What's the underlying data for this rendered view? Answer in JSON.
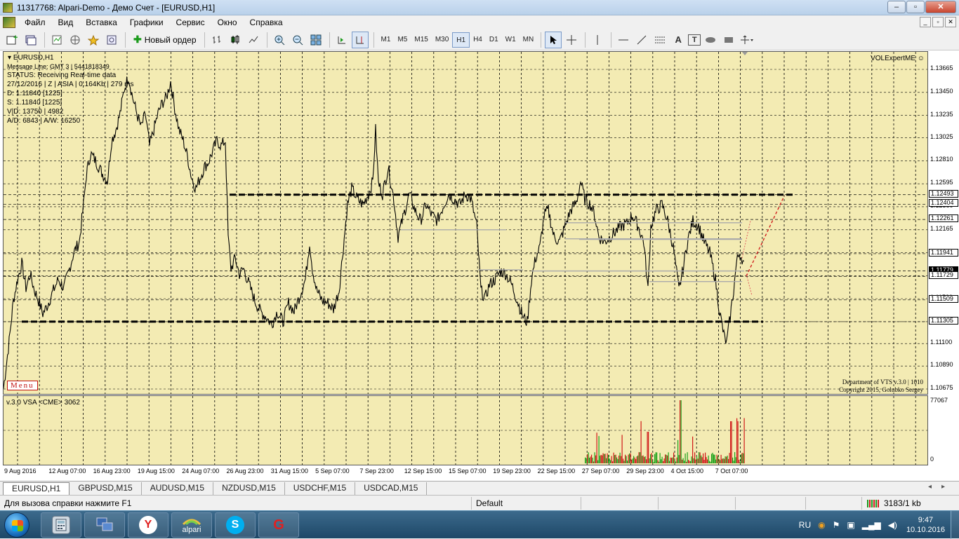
{
  "window": {
    "title": "11317768: Alpari-Demo - Демо Счет - [EURUSD,H1]",
    "buttons": {
      "minimize": "–",
      "maximize": "▫",
      "close": "✕"
    }
  },
  "menu": {
    "items": [
      "Файл",
      "Вид",
      "Вставка",
      "Графики",
      "Сервис",
      "Окно",
      "Справка"
    ],
    "mdi": {
      "minimize": "_",
      "restore": "▫",
      "close": "✕"
    }
  },
  "toolbar": {
    "new_order": "Новый ордер",
    "timeframes": [
      "M1",
      "M5",
      "M15",
      "M30",
      "H1",
      "H4",
      "D1",
      "W1",
      "MN"
    ],
    "active_timeframe": "H1",
    "text_tool": "A",
    "text_label_tool": "T"
  },
  "chart": {
    "symbol_label": "EURUSD,H1",
    "info_lines": [
      "Message Line: GMT 3  |  5441818349",
      "STATUS:  Receiving Real-time data",
      "27/12/2016 | Z | ASIA | 0.164Kb | 279 ms",
      "D: 1.11840 [1225]",
      "S: 1.11840 [1225]",
      "V|D: 13750 | 4982",
      "A/D: 6843 | A/W: 16250"
    ],
    "expert_label": "VOLExpertME",
    "copyright_lines": [
      "Department of VTS  v.3.0 | 1010",
      "Copyright 2015, Golubko Sergey"
    ],
    "menu_button": "Menu",
    "price_ticks": [
      "1.13665",
      "1.13450",
      "1.13235",
      "1.13025",
      "1.12810",
      "1.12595",
      "1.12380",
      "1.12165",
      "1.11950",
      "1.11735",
      "1.11520",
      "1.11305",
      "1.11100",
      "1.10890",
      "1.10675"
    ],
    "price_markers": [
      {
        "value": "1.12493",
        "dark": false
      },
      {
        "value": "1.12404",
        "dark": false
      },
      {
        "value": "1.12261",
        "dark": false
      },
      {
        "value": "1.11941",
        "dark": false
      },
      {
        "value": "1.11779",
        "dark": true
      },
      {
        "value": "1.11729",
        "dark": false
      },
      {
        "value": "1.11509",
        "dark": false
      },
      {
        "value": "1.11305",
        "dark": false
      }
    ],
    "time_ticks": [
      "9 Aug 2016",
      "12 Aug 07:00",
      "16 Aug 23:00",
      "19 Aug 15:00",
      "24 Aug 07:00",
      "26 Aug 23:00",
      "31 Aug 15:00",
      "5 Sep 07:00",
      "7 Sep 23:00",
      "12 Sep 15:00",
      "15 Sep 07:00",
      "19 Sep 23:00",
      "22 Sep 15:00",
      "27 Sep 07:00",
      "29 Sep 23:00",
      "4 Oct 15:00",
      "7 Oct 07:00"
    ]
  },
  "indicator": {
    "label": "v.3.0  VSA  <CME>  3062",
    "axis_top": "77067",
    "axis_bottom": "0"
  },
  "tabs": [
    "EURUSD,H1",
    "GBPUSD,M15",
    "AUDUSD,M15",
    "NZDUSD,M15",
    "USDCHF,M15",
    "USDCAD,M15"
  ],
  "active_tab": "EURUSD,H1",
  "status": {
    "help": "Для вызова справки нажмите F1",
    "profile": "Default",
    "traffic": "3183/1 kb"
  },
  "taskbar": {
    "apps": [
      {
        "name": "calculator",
        "label": ""
      },
      {
        "name": "network",
        "label": ""
      },
      {
        "name": "yandex",
        "label": "Y"
      },
      {
        "name": "alpari",
        "label": "alpari"
      },
      {
        "name": "skype",
        "label": "S"
      },
      {
        "name": "g-app",
        "label": "G"
      }
    ],
    "lang": "RU",
    "time": "9:47",
    "date": "10.10.2016"
  },
  "colors": {
    "chart_bg": "#f3ebb3",
    "accent_red": "#c01010",
    "volume_red": "#d01818",
    "volume_green": "#18a018"
  }
}
